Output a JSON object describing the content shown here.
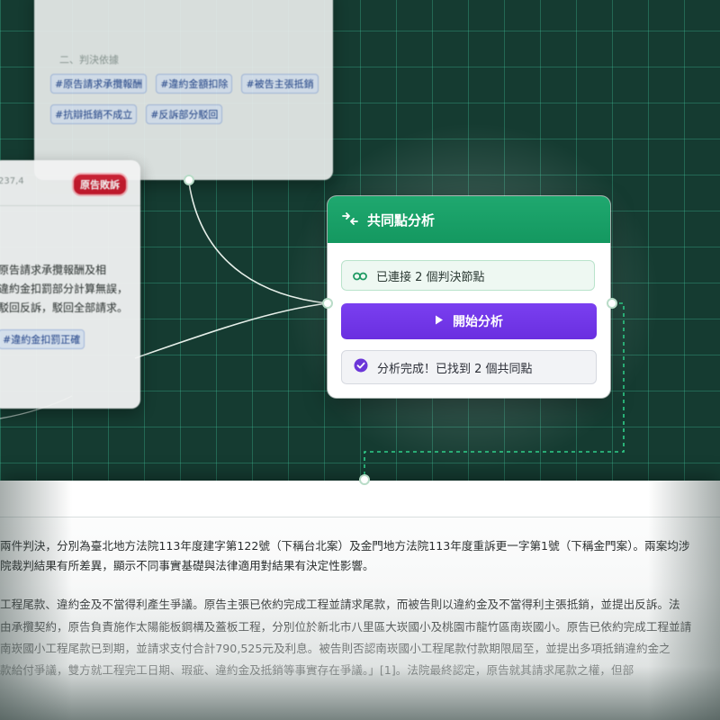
{
  "top_node": {
    "header": "二、判決依據",
    "tags": [
      "#原告請求承攬報酬",
      "#違約金額扣除",
      "#被告主張抵銷",
      "#抗辯抵銷不成立",
      "#反訴部分駁回"
    ]
  },
  "left_node": {
    "amount": "237,4",
    "badge": "原告敗訴",
    "body_lines": [
      "原告請求承攬報酬及相",
      "違約金扣罰部分計算無誤，",
      "駁回反訴，駁回全部請求。"
    ],
    "tag": "#違約金扣罰正確"
  },
  "analysis_node": {
    "title": "共同點分析",
    "header_icon": "merge-arrows-icon",
    "connected_text": "已連接 2 個判決節點",
    "connected_icon": "link-icon",
    "start_button": "開始分析",
    "start_icon": "play-icon",
    "status_text": "分析完成！已找到 2 個共同點",
    "status_icon": "check-circle-icon",
    "colors": {
      "header": "#1aa46a",
      "button": "#7038e8",
      "check": "#6b36d8"
    }
  },
  "document": {
    "lines": [
      "兩件判決，分別為臺北地方法院113年度建字第122號（下稱台北案）及金門地方法院113年度重訴更一字第1號（下稱金門案）。兩案均涉",
      "院裁判結果有所差異，顯示不同事實基礎與法律適用對結果有決定性影響。",
      "工程尾款、違約金及不當得利產生爭議。原告主張已依約完成工程並請求尾款，而被告則以違約金及不當得利主張抵銷，並提出反訴。法",
      "由承攬契約，原告負責施作太陽能板鋼構及蓋板工程，分別位於新北市八里區大崁國小及桃園市龍竹區南崁國小。原告已依約完成工程並請",
      "南崁國小工程尾款已到期，並請求支付合計790,525元及利息。被告則否認南崁國小工程尾款付款期限屆至，並提出多項抵銷違約金之",
      "款給付爭議，雙方就工程完工日期、瑕疵、違約金及抵銷等事實存在爭議。」[1]。法院最終認定，原告就其請求尾款之權，但部"
    ]
  }
}
